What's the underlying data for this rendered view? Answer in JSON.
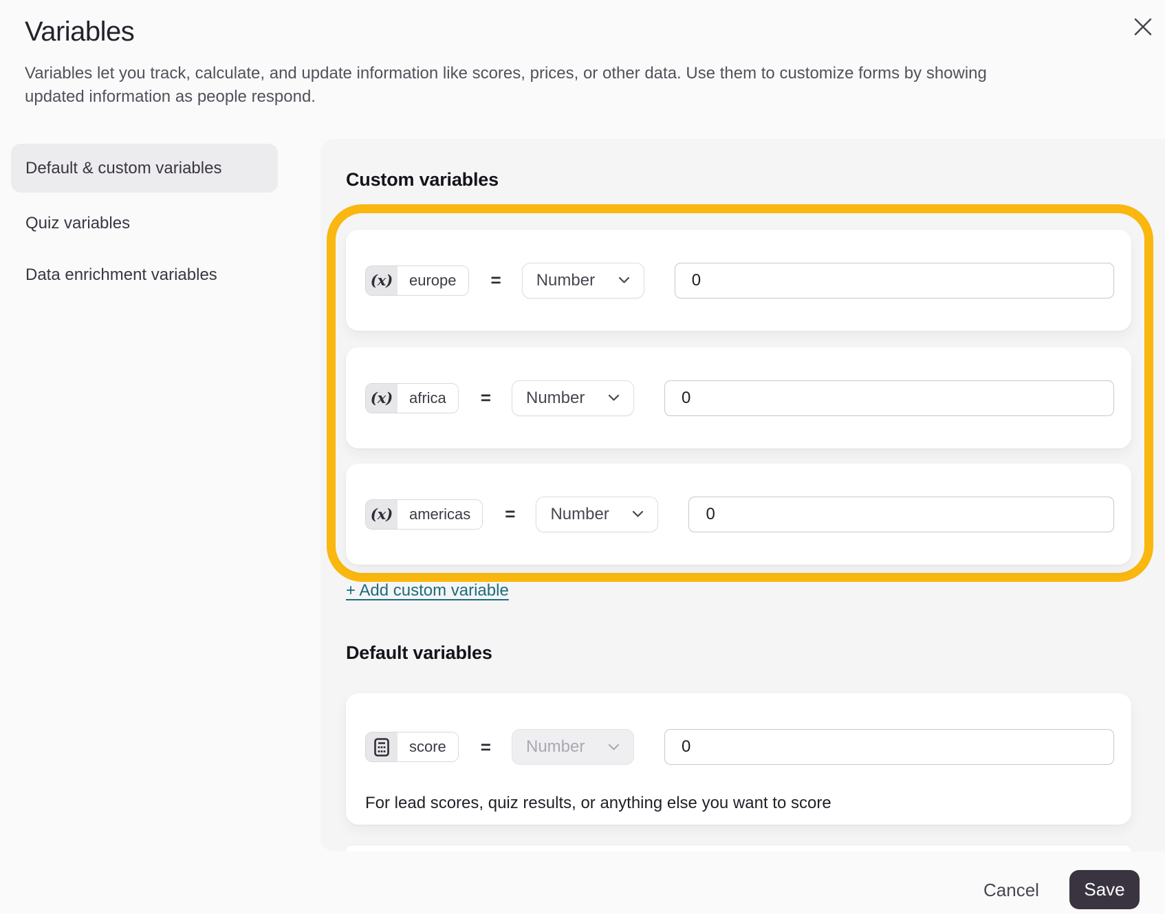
{
  "modal": {
    "title": "Variables",
    "description": "Variables let you track, calculate, and update information like scores, prices, or other data. Use them to customize forms by showing updated information as people respond.",
    "close_icon": "close-icon"
  },
  "sidebar": {
    "items": [
      {
        "label": "Default & custom variables",
        "selected": true
      },
      {
        "label": "Quiz variables",
        "selected": false
      },
      {
        "label": "Data enrichment variables",
        "selected": false
      }
    ]
  },
  "panel": {
    "custom_section": {
      "heading": "Custom variables",
      "rows": [
        {
          "icon": "variable-icon",
          "icon_glyph": "(x)",
          "name": "europe",
          "equals": "=",
          "type": "Number",
          "value": "0"
        },
        {
          "icon": "variable-icon",
          "icon_glyph": "(x)",
          "name": "africa",
          "equals": "=",
          "type": "Number",
          "value": "0"
        },
        {
          "icon": "variable-icon",
          "icon_glyph": "(x)",
          "name": "americas",
          "equals": "=",
          "type": "Number",
          "value": "0"
        }
      ],
      "add_link": "+ Add custom variable"
    },
    "default_section": {
      "heading": "Default variables",
      "row": {
        "icon": "calculator-icon",
        "name": "score",
        "equals": "=",
        "type": "Number",
        "type_disabled": true,
        "value": "0",
        "helper": "For lead scores, quiz results, or anything else you want to score"
      }
    }
  },
  "footer": {
    "cancel_label": "Cancel",
    "save_label": "Save"
  },
  "colors": {
    "annotation_highlight": "#f9b70f",
    "link_teal": "#1d6c7d",
    "save_button_bg": "#3a3441",
    "panel_bg": "#f5f5f6",
    "selected_tab_bg": "#ecebee",
    "chip_icon_bg": "#e7e6e9"
  }
}
